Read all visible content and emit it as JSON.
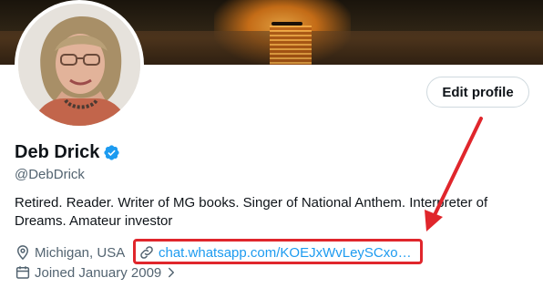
{
  "profile": {
    "name": "Deb Drick",
    "handle": "@DebDrick",
    "bio": "Retired. Reader. Writer of MG books. Singer of National Anthem. Interpreter of Dreams. Amateur investor",
    "location": "Michigan, USA",
    "url": "chat.whatsapp.com/KOEJxWvLeySCxo…",
    "joined": "Joined January 2009"
  },
  "actions": {
    "edit_profile": "Edit profile"
  },
  "colors": {
    "accent": "#1d9bf0",
    "annotation": "#e0262c",
    "muted": "#536471"
  },
  "icons": {
    "verified": "verified-badge-icon",
    "location": "location-pin-icon",
    "link": "link-icon",
    "calendar": "calendar-icon",
    "chevron": "chevron-right-icon"
  }
}
